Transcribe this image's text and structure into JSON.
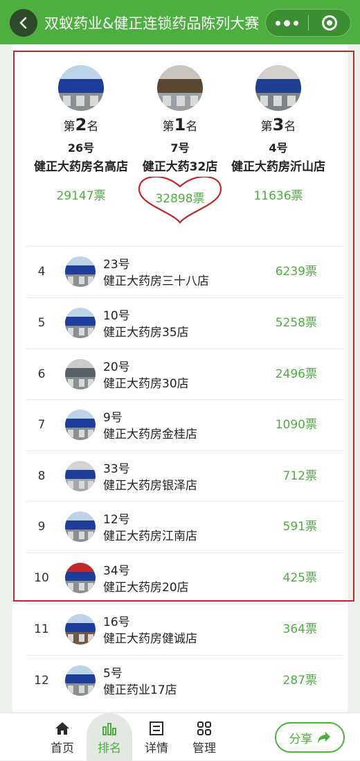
{
  "header": {
    "title": "双蚁药业&健正连锁药品陈列大赛"
  },
  "podium": [
    {
      "rank_prefix": "第",
      "rank": "2",
      "rank_suffix": "名",
      "number": "26号",
      "name": "健正大药房名高店",
      "votes": "29147票"
    },
    {
      "rank_prefix": "第",
      "rank": "1",
      "rank_suffix": "名",
      "number": "7号",
      "name": "健正大药32店",
      "votes": "32898票"
    },
    {
      "rank_prefix": "第",
      "rank": "3",
      "rank_suffix": "名",
      "number": "4号",
      "name": "健正大药房沂山店",
      "votes": "11636票"
    }
  ],
  "rows": [
    {
      "rank": "4",
      "number": "23号",
      "name": "健正大药房三十八店",
      "votes": "6239票"
    },
    {
      "rank": "5",
      "number": "10号",
      "name": "健正大药房35店",
      "votes": "5258票"
    },
    {
      "rank": "6",
      "number": "20号",
      "name": "健正大药房30店",
      "votes": "2496票"
    },
    {
      "rank": "7",
      "number": "9号",
      "name": "健正大药房金桂店",
      "votes": "1090票"
    },
    {
      "rank": "8",
      "number": "33号",
      "name": "健正大药房银泽店",
      "votes": "712票"
    },
    {
      "rank": "9",
      "number": "12号",
      "name": "健正大药房江南店",
      "votes": "591票"
    },
    {
      "rank": "10",
      "number": "34号",
      "name": "健正大药房20店",
      "votes": "425票"
    },
    {
      "rank": "11",
      "number": "16号",
      "name": "健正大药房健诚店",
      "votes": "364票"
    },
    {
      "rank": "12",
      "number": "5号",
      "name": "健正药业17店",
      "votes": "287票"
    }
  ],
  "tabs": [
    {
      "label": "首页",
      "icon": "home-icon"
    },
    {
      "label": "排名",
      "icon": "bar-chart-icon"
    },
    {
      "label": "详情",
      "icon": "document-icon"
    },
    {
      "label": "管理",
      "icon": "grid-icon"
    }
  ],
  "share": {
    "label": "分享"
  },
  "colors": {
    "brand_green": "#4caf3f",
    "highlight_red": "#c0272d"
  }
}
